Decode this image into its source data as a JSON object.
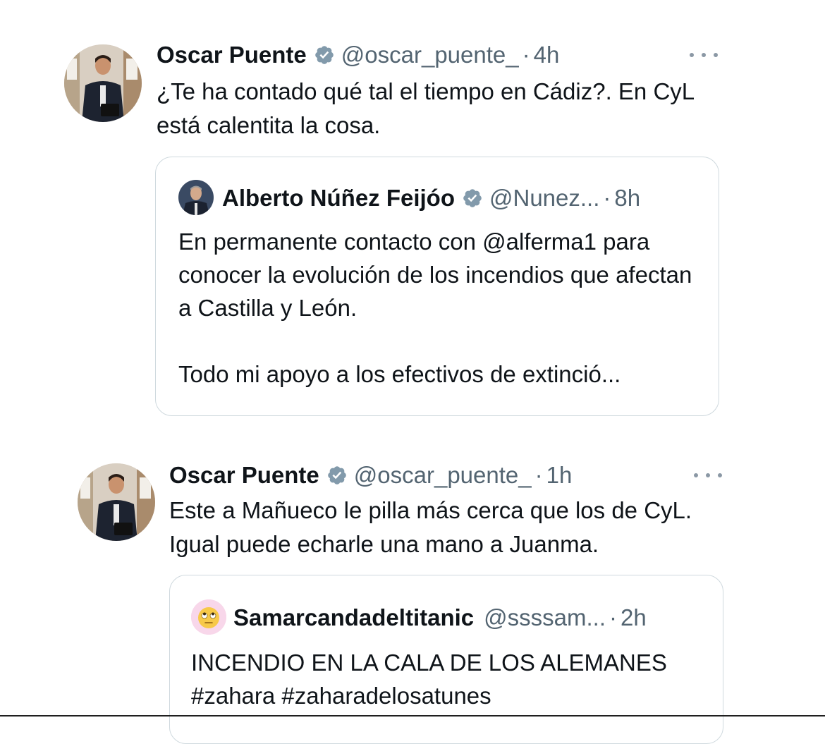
{
  "tweets": [
    {
      "author_name": "Oscar Puente",
      "handle": "@oscar_puente_",
      "separator": "·",
      "time": "4h",
      "text": "¿Te ha contado qué tal el tiempo en Cádiz?. En CyL está calentita la cosa.",
      "quote": {
        "author_name": "Alberto Núñez Feijóo",
        "handle": "@Nunez...",
        "separator": "·",
        "time": "8h",
        "text": "En permanente contacto con @alferma1 para conocer la evolución de los incendios que afectan a Castilla y León.\n\nTodo mi apoyo a los efectivos de extinció..."
      }
    },
    {
      "author_name": "Oscar Puente",
      "handle": "@oscar_puente_",
      "separator": "·",
      "time": "1h",
      "text": "Este a Mañueco le pilla más cerca que los de CyL. Igual puede echarle una mano a Juanma.",
      "quote": {
        "author_name": "Samarcandadeltitanic",
        "handle": "@ssssam...",
        "separator": "·",
        "time": "2h",
        "text": "INCENDIO EN LA CALA DE LOS ALEMANES\n#zahara #zaharadelosatunes"
      }
    }
  ],
  "icons": {
    "verified": "verified-badge-icon",
    "more": "more-options-icon",
    "emoji_avatar": "rolling-eyes-emoji-icon"
  },
  "colors": {
    "text": "#0f1419",
    "secondary": "#536471",
    "border": "#cfd9de",
    "verified_gray": "#829aab"
  }
}
